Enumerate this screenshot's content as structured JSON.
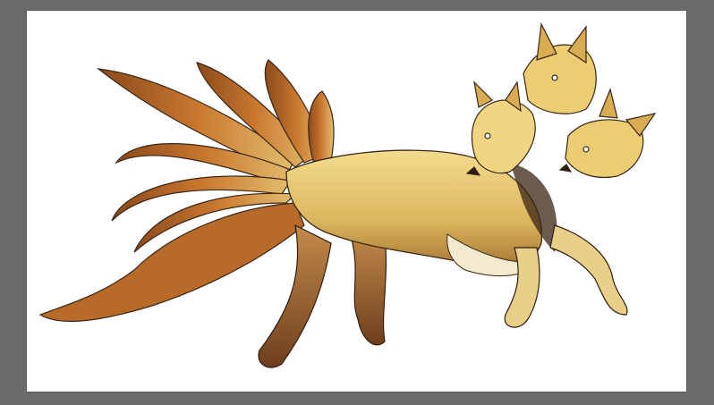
{
  "app": {
    "workspace_color": "#6b6b6b",
    "canvas_color": "#ffffff"
  },
  "artwork": {
    "palette": {
      "fur_light": "#f3dc8e",
      "fur_mid": "#dcb65f",
      "fur_dark": "#a87934",
      "tail_orange": "#c9772f",
      "shadow": "#3a2614",
      "belly_white": "#f4ead0"
    }
  }
}
